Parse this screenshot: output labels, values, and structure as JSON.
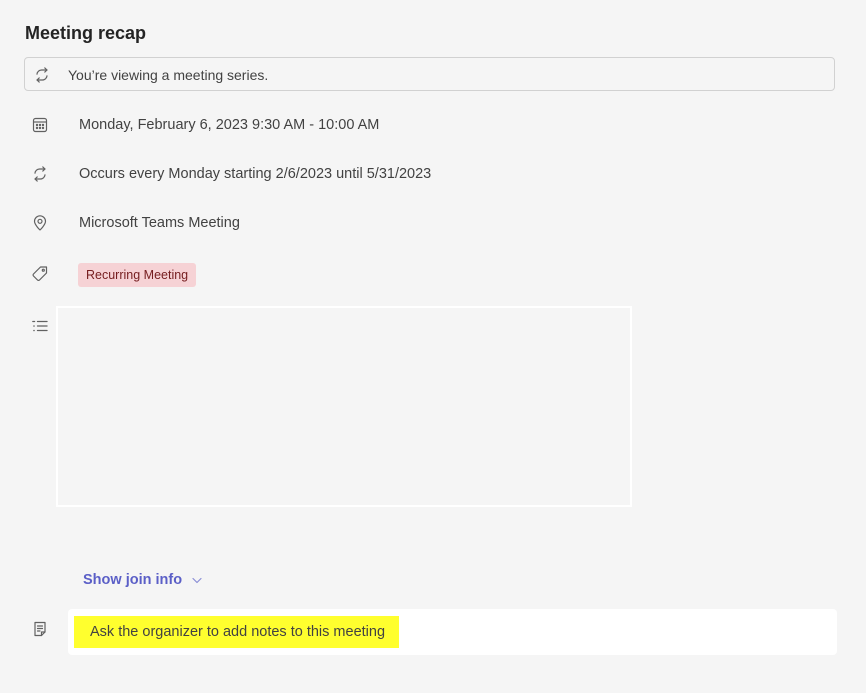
{
  "header": {
    "title": "Meeting recap"
  },
  "banner": {
    "icon": "series-repeat-icon",
    "text": "You’re viewing a meeting series."
  },
  "details": {
    "datetime": {
      "icon": "calendar-icon",
      "text": "Monday, February 6, 2023 9:30 AM - 10:00 AM"
    },
    "recurrence": {
      "icon": "repeat-icon",
      "text": "Occurs every Monday starting 2/6/2023 until 5/31/2023"
    },
    "location": {
      "icon": "location-pin-icon",
      "text": "Microsoft Teams Meeting"
    },
    "category": {
      "icon": "tag-icon",
      "label": "Recurring Meeting",
      "color_bg": "#f6d2d5",
      "color_fg": "#751d1f"
    },
    "description": {
      "icon": "text-bullet-list-icon"
    }
  },
  "join_info": {
    "label": "Show join info",
    "icon": "chevron-down-icon",
    "color": "#5b5fc7"
  },
  "notes": {
    "icon": "notes-icon",
    "text": "Ask the organizer to add notes to this meeting",
    "highlight_color": "#ffff2e"
  }
}
